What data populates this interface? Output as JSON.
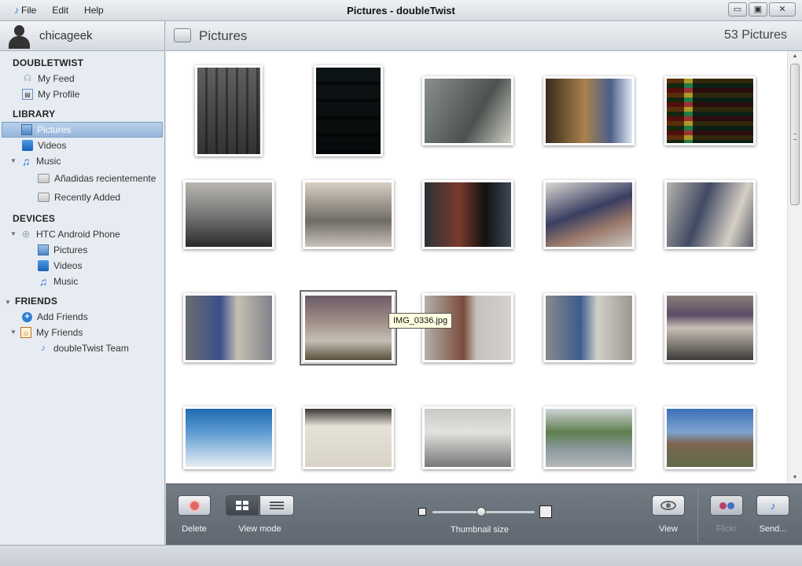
{
  "window": {
    "title": "Pictures - doubleTwist",
    "menu": [
      "File",
      "Edit",
      "Help"
    ],
    "controls": {
      "minimize": "▭",
      "restore": "▣",
      "close": "✕"
    }
  },
  "user": {
    "name": "chicageek"
  },
  "sidebar": {
    "doubletwist": {
      "title": "DOUBLETWIST",
      "items": [
        "My Feed",
        "My Profile"
      ]
    },
    "library": {
      "title": "LIBRARY",
      "items": [
        "Pictures",
        "Videos",
        "Music"
      ],
      "music_children": [
        "Añadidas recientemente",
        "Recently Added"
      ],
      "selected": "Pictures"
    },
    "devices": {
      "title": "DEVICES",
      "device": "HTC Android Phone",
      "children": [
        "Pictures",
        "Videos",
        "Music"
      ]
    },
    "friends": {
      "title": "FRIENDS",
      "items": [
        "Add Friends",
        "My Friends"
      ],
      "my_friends_children": [
        "doubleTwist Team"
      ]
    }
  },
  "main": {
    "title": "Pictures",
    "count": "53 Pictures",
    "tooltip": "IMG_0336.jpg",
    "thumbnails": [
      {
        "bg": "linear-gradient(#8f8f8f,#4c4c4c)",
        "overlay": "repeating-linear-gradient(90deg,#aaa 0 10px,#6b6b6b 10px 13px)"
      },
      {
        "bg": "linear-gradient(#2f3b3b,#141c1f)",
        "overlay": "repeating-linear-gradient(#4c5a5c 0 18px,#1f2729 18px 22px)"
      },
      {
        "bg": "linear-gradient(120deg,#8a8f8b,#4b524f 60%,#cfcfc5)",
        "overlay": ""
      },
      {
        "bg": "linear-gradient(90deg,#3a2a1c,#a9814c 45%,#4d5f8a 75%,#dfe7f5)",
        "overlay": ""
      },
      {
        "bg": "linear-gradient(90deg,#6a4335 0 20%,#cfd8dd 20% 30%,#3a3942 30%)",
        "overlay": "repeating-linear-gradient(#d6b32b 0 6px,#2e8f4e 6px 12px,#c03a3a 12px 18px)"
      },
      {
        "bg": "linear-gradient(#b9b6b0,#777 50%,#2a2a2a)",
        "overlay": ""
      },
      {
        "bg": "linear-gradient(#d8cfc2,#6f6b65 60%,#c9c3ba)",
        "overlay": ""
      },
      {
        "bg": "linear-gradient(90deg,#2a3138,#7b3b2c 40%,#111 70%,#3d4a55)",
        "overlay": ""
      },
      {
        "bg": "linear-gradient(160deg,#dcdad5,#3a3e61 45%,#9b7a6b 70%,#c9c6c1)",
        "overlay": ""
      },
      {
        "bg": "linear-gradient(110deg,#b7b4ad,#414a63 40%,#d6cfc5 75%,#5b5f6a)",
        "overlay": ""
      },
      {
        "bg": "linear-gradient(90deg,#6b6d72,#3b4e8a 40%,#c6bfb2 60%,#7e8288)",
        "overlay": ""
      },
      {
        "bg": "linear-gradient(#6b5a66,#9f8f86 40%,#c5bfb6 70%,#5a4f3a)",
        "overlay": ""
      },
      {
        "bg": "linear-gradient(90deg,#b4b0aa,#7a4b3b 45%,#c4c2bd 60%,#d5d2cd)",
        "overlay": ""
      },
      {
        "bg": "linear-gradient(90deg,#8a8a8a,#3c5b8c 40%,#d2cfc9 60%,#9b9791)",
        "overlay": ""
      },
      {
        "bg": "linear-gradient(#8a8178,#5e4a66 30%,#c7c0b6 50%,#3d3a37)",
        "overlay": ""
      },
      {
        "bg": "linear-gradient(#1f6bb0,#5c9bd1 40%,#e7eef5)",
        "overlay": ""
      },
      {
        "bg": "linear-gradient(#3a3632,#e6e2d8 30%,#d8d3c6)",
        "overlay": ""
      },
      {
        "bg": "linear-gradient(#c9c9c6,#e2e1dd 40%,#777)",
        "overlay": ""
      },
      {
        "bg": "linear-gradient(#cfd3d6,#5f7f4f 40%,#8c9a9e 70%,#b4b8ba)",
        "overlay": ""
      },
      {
        "bg": "linear-gradient(#3d6fb8,#7ea3cf 40%,#7c6552 60%,#5f6b4b)",
        "overlay": ""
      }
    ]
  },
  "toolbar": {
    "delete": "Delete",
    "view_mode": "View mode",
    "thumbnail_size": "Thumbnail size",
    "thumbnail_size_value": 0.48,
    "view": "View",
    "flickr": "Flickr",
    "send": "Send..."
  },
  "colors": {
    "accent": "#2c7ad6",
    "toolbar": "#6b737c",
    "selection": "#96b6dc"
  }
}
